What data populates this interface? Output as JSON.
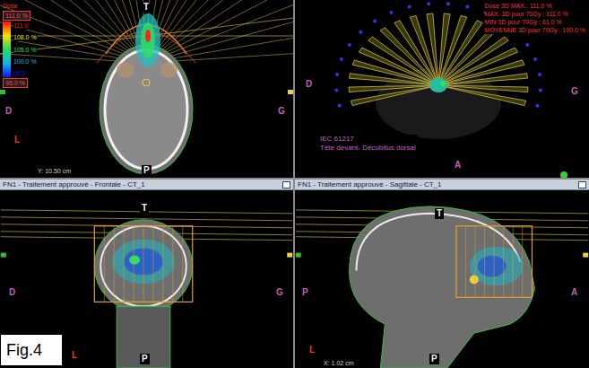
{
  "figure_label": "Fig.4",
  "axial": {
    "dose_legend": {
      "title": "Dose",
      "max_box": "111.0 %",
      "min_box": "95.0 %",
      "ticks": [
        {
          "label": "111.0",
          "color": "#ff1010"
        },
        {
          "label": "108.0 %",
          "color": "#ffe000"
        },
        {
          "label": "105.0 %",
          "color": "#20e060"
        },
        {
          "label": "100.0 %",
          "color": "#10b8e8"
        },
        {
          "label": "95.0",
          "color": "#1010ff"
        }
      ]
    },
    "orientation": {
      "top": "T",
      "left": "D",
      "right": "G",
      "bottom": "P"
    },
    "axis_marker": "L",
    "coordinate": "Y: 10.50 cm"
  },
  "view3d": {
    "dose_stats": [
      "Dose 3D MAX.: 111.0 %",
      "MAX. 3D pour 70Gy : 111.0 %",
      "MIN 3D pour 70Gy : 61.0 %",
      "MOYENNE 3D pour 70Gy : 100.0 %"
    ],
    "orientation": {
      "left": "D",
      "right": "G",
      "bottom": "A"
    },
    "standard": "IEC 61217",
    "patient_position": "Tête devant- Décubitus dorsal"
  },
  "frontal": {
    "title": "FN1 - Traitement approuvé - Frontale - CT_1",
    "orientation": {
      "top": "T",
      "left": "D",
      "right": "G",
      "bottom": "P"
    },
    "axis_marker": "L"
  },
  "sagittal": {
    "title": "FN1 - Traitement approuvé - Sagittale - CT_1",
    "orientation": {
      "top": "T",
      "left": "P",
      "right": "A",
      "bottom": "P"
    },
    "axis_marker": "L",
    "coordinate": "X: 1.02 cm"
  }
}
